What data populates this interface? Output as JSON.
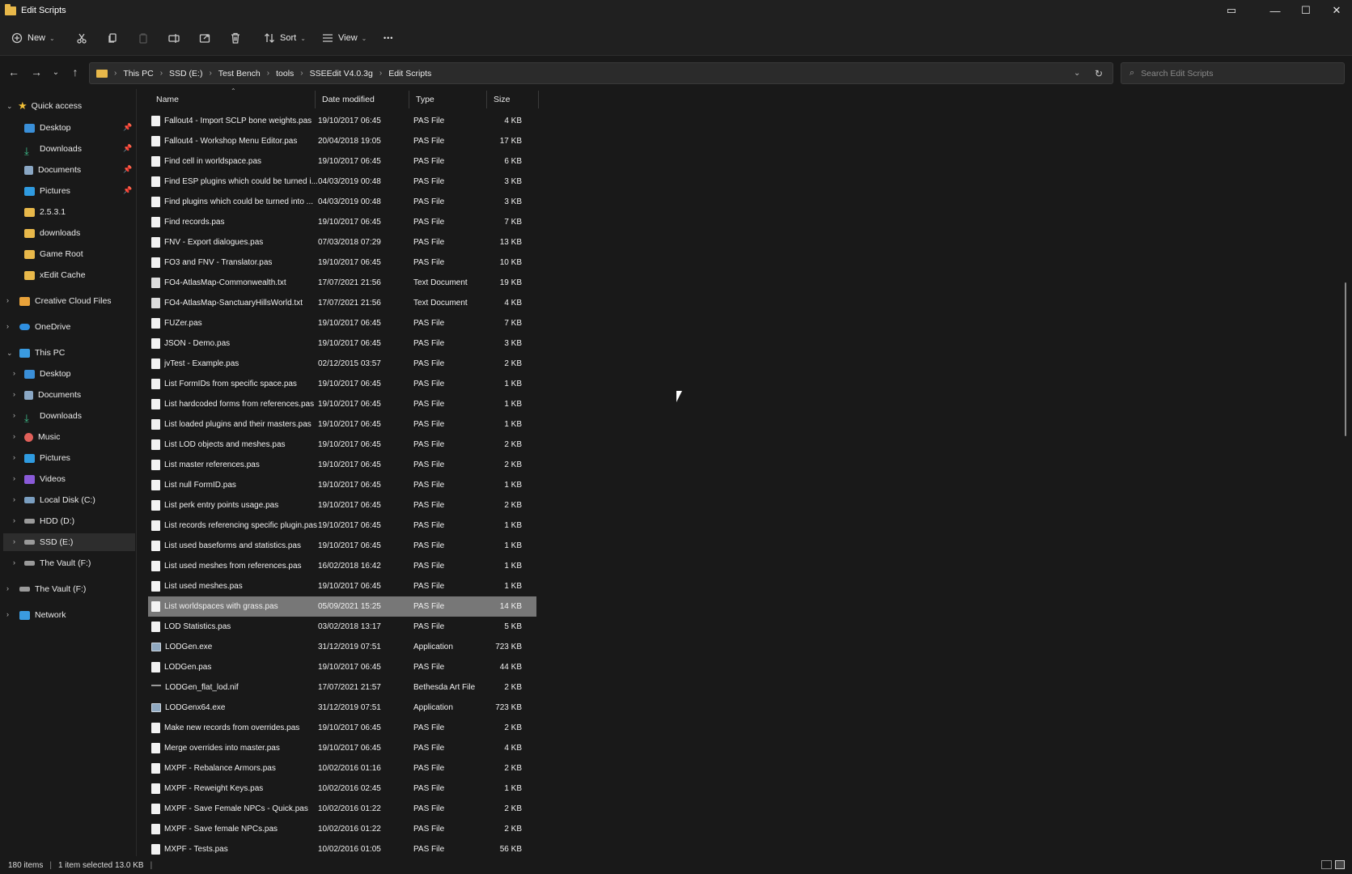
{
  "window": {
    "title": "Edit Scripts",
    "controls": {
      "minimize": "—",
      "maximize": "☐",
      "close": "✕"
    }
  },
  "toolbar": {
    "new_label": "New",
    "sort_label": "Sort",
    "view_label": "View",
    "more_label": "•••"
  },
  "address": {
    "crumbs": [
      "This PC",
      "SSD (E:)",
      "Test Bench",
      "tools",
      "SSEEdit V4.0.3g",
      "Edit Scripts"
    ],
    "search_placeholder": "Search Edit Scripts"
  },
  "sidebar": {
    "quick_access": "Quick access",
    "quick_items": [
      "Desktop",
      "Downloads",
      "Documents",
      "Pictures",
      "2.5.3.1",
      "downloads",
      "Game Root",
      "xEdit Cache"
    ],
    "creative_cloud": "Creative Cloud Files",
    "onedrive": "OneDrive",
    "this_pc": "This PC",
    "pc_items": [
      "Desktop",
      "Documents",
      "Downloads",
      "Music",
      "Pictures",
      "Videos",
      "Local Disk (C:)",
      "HDD (D:)",
      "SSD (E:)",
      "The Vault (F:)"
    ],
    "vault": "The Vault (F:)",
    "network": "Network"
  },
  "columns": {
    "name": "Name",
    "date": "Date modified",
    "type": "Type",
    "size": "Size"
  },
  "files": [
    {
      "name": "Fallout4 - Import SCLP bone weights.pas",
      "date": "19/10/2017 06:45",
      "type": "PAS File",
      "size": "4 KB",
      "icon": "file"
    },
    {
      "name": "Fallout4 - Workshop Menu Editor.pas",
      "date": "20/04/2018 19:05",
      "type": "PAS File",
      "size": "17 KB",
      "icon": "file"
    },
    {
      "name": "Find cell in worldspace.pas",
      "date": "19/10/2017 06:45",
      "type": "PAS File",
      "size": "6 KB",
      "icon": "file"
    },
    {
      "name": "Find ESP plugins which could be turned i...",
      "date": "04/03/2019 00:48",
      "type": "PAS File",
      "size": "3 KB",
      "icon": "file"
    },
    {
      "name": "Find plugins which could be turned into ...",
      "date": "04/03/2019 00:48",
      "type": "PAS File",
      "size": "3 KB",
      "icon": "file"
    },
    {
      "name": "Find records.pas",
      "date": "19/10/2017 06:45",
      "type": "PAS File",
      "size": "7 KB",
      "icon": "file"
    },
    {
      "name": "FNV - Export dialogues.pas",
      "date": "07/03/2018 07:29",
      "type": "PAS File",
      "size": "13 KB",
      "icon": "file"
    },
    {
      "name": "FO3 and FNV - Translator.pas",
      "date": "19/10/2017 06:45",
      "type": "PAS File",
      "size": "10 KB",
      "icon": "file"
    },
    {
      "name": "FO4-AtlasMap-Commonwealth.txt",
      "date": "17/07/2021 21:56",
      "type": "Text Document",
      "size": "19 KB",
      "icon": "txt"
    },
    {
      "name": "FO4-AtlasMap-SanctuaryHillsWorld.txt",
      "date": "17/07/2021 21:56",
      "type": "Text Document",
      "size": "4 KB",
      "icon": "txt"
    },
    {
      "name": "FUZer.pas",
      "date": "19/10/2017 06:45",
      "type": "PAS File",
      "size": "7 KB",
      "icon": "file"
    },
    {
      "name": "JSON - Demo.pas",
      "date": "19/10/2017 06:45",
      "type": "PAS File",
      "size": "3 KB",
      "icon": "file"
    },
    {
      "name": "jvTest - Example.pas",
      "date": "02/12/2015 03:57",
      "type": "PAS File",
      "size": "2 KB",
      "icon": "file"
    },
    {
      "name": "List FormIDs from specific space.pas",
      "date": "19/10/2017 06:45",
      "type": "PAS File",
      "size": "1 KB",
      "icon": "file"
    },
    {
      "name": "List hardcoded forms from references.pas",
      "date": "19/10/2017 06:45",
      "type": "PAS File",
      "size": "1 KB",
      "icon": "file"
    },
    {
      "name": "List loaded plugins and their masters.pas",
      "date": "19/10/2017 06:45",
      "type": "PAS File",
      "size": "1 KB",
      "icon": "file"
    },
    {
      "name": "List LOD objects and meshes.pas",
      "date": "19/10/2017 06:45",
      "type": "PAS File",
      "size": "2 KB",
      "icon": "file"
    },
    {
      "name": "List master references.pas",
      "date": "19/10/2017 06:45",
      "type": "PAS File",
      "size": "2 KB",
      "icon": "file"
    },
    {
      "name": "List null FormID.pas",
      "date": "19/10/2017 06:45",
      "type": "PAS File",
      "size": "1 KB",
      "icon": "file"
    },
    {
      "name": "List perk entry points usage.pas",
      "date": "19/10/2017 06:45",
      "type": "PAS File",
      "size": "2 KB",
      "icon": "file"
    },
    {
      "name": "List records referencing specific plugin.pas",
      "date": "19/10/2017 06:45",
      "type": "PAS File",
      "size": "1 KB",
      "icon": "file"
    },
    {
      "name": "List used baseforms and statistics.pas",
      "date": "19/10/2017 06:45",
      "type": "PAS File",
      "size": "1 KB",
      "icon": "file"
    },
    {
      "name": "List used meshes from references.pas",
      "date": "16/02/2018 16:42",
      "type": "PAS File",
      "size": "1 KB",
      "icon": "file"
    },
    {
      "name": "List used meshes.pas",
      "date": "19/10/2017 06:45",
      "type": "PAS File",
      "size": "1 KB",
      "icon": "file"
    },
    {
      "name": "List worldspaces with grass.pas",
      "date": "05/09/2021 15:25",
      "type": "PAS File",
      "size": "14 KB",
      "icon": "file",
      "selected": true
    },
    {
      "name": "LOD Statistics.pas",
      "date": "03/02/2018 13:17",
      "type": "PAS File",
      "size": "5 KB",
      "icon": "file"
    },
    {
      "name": "LODGen.exe",
      "date": "31/12/2019 07:51",
      "type": "Application",
      "size": "723 KB",
      "icon": "exe"
    },
    {
      "name": "LODGen.pas",
      "date": "19/10/2017 06:45",
      "type": "PAS File",
      "size": "44 KB",
      "icon": "file"
    },
    {
      "name": "LODGen_flat_lod.nif",
      "date": "17/07/2021 21:57",
      "type": "Bethesda Art File",
      "size": "2 KB",
      "icon": "nif"
    },
    {
      "name": "LODGenx64.exe",
      "date": "31/12/2019 07:51",
      "type": "Application",
      "size": "723 KB",
      "icon": "exe"
    },
    {
      "name": "Make new records from overrides.pas",
      "date": "19/10/2017 06:45",
      "type": "PAS File",
      "size": "2 KB",
      "icon": "file"
    },
    {
      "name": "Merge overrides into master.pas",
      "date": "19/10/2017 06:45",
      "type": "PAS File",
      "size": "4 KB",
      "icon": "file"
    },
    {
      "name": "MXPF - Rebalance Armors.pas",
      "date": "10/02/2016 01:16",
      "type": "PAS File",
      "size": "2 KB",
      "icon": "file"
    },
    {
      "name": "MXPF - Reweight Keys.pas",
      "date": "10/02/2016 02:45",
      "type": "PAS File",
      "size": "1 KB",
      "icon": "file"
    },
    {
      "name": "MXPF - Save Female NPCs - Quick.pas",
      "date": "10/02/2016 01:22",
      "type": "PAS File",
      "size": "2 KB",
      "icon": "file"
    },
    {
      "name": "MXPF - Save female NPCs.pas",
      "date": "10/02/2016 01:22",
      "type": "PAS File",
      "size": "2 KB",
      "icon": "file"
    },
    {
      "name": "MXPF - Tests.pas",
      "date": "10/02/2016 01:05",
      "type": "PAS File",
      "size": "56 KB",
      "icon": "file"
    }
  ],
  "status": {
    "count": "180 items",
    "selected": "1 item selected  13.0 KB"
  }
}
